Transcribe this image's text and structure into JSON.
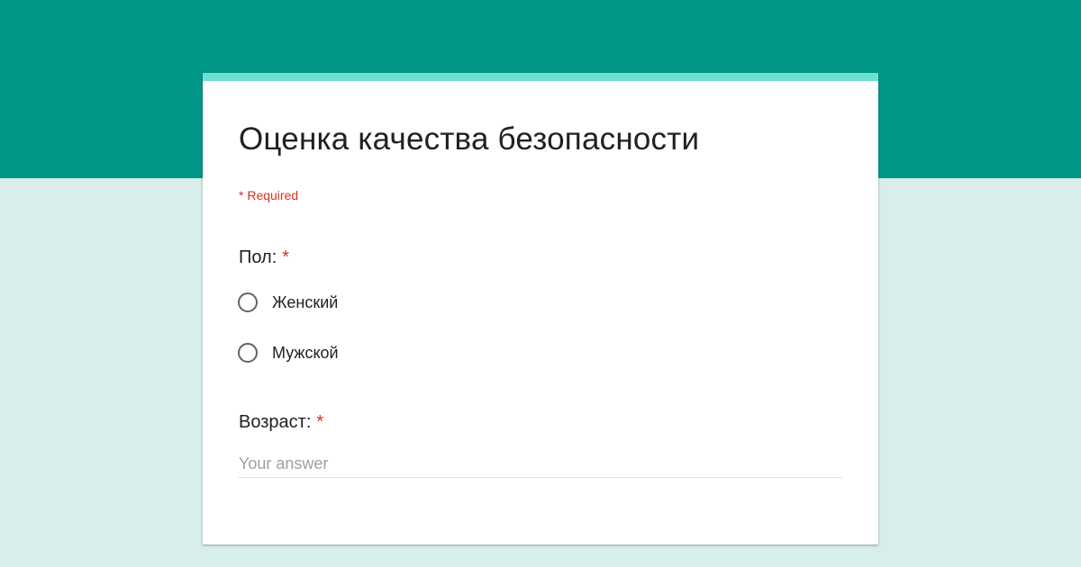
{
  "form": {
    "title": "Оценка качества безопасности",
    "required_note": "* Required",
    "questions": [
      {
        "label": "Пол:",
        "required_marker": "*",
        "options": [
          "Женский",
          "Мужской"
        ]
      },
      {
        "label": "Возраст:",
        "required_marker": "*",
        "placeholder": "Your answer"
      }
    ]
  },
  "colors": {
    "header_band": "#009688",
    "page_background": "#d8eeeb",
    "card_accent": "#6ee0cf",
    "required_red": "#d93025"
  }
}
